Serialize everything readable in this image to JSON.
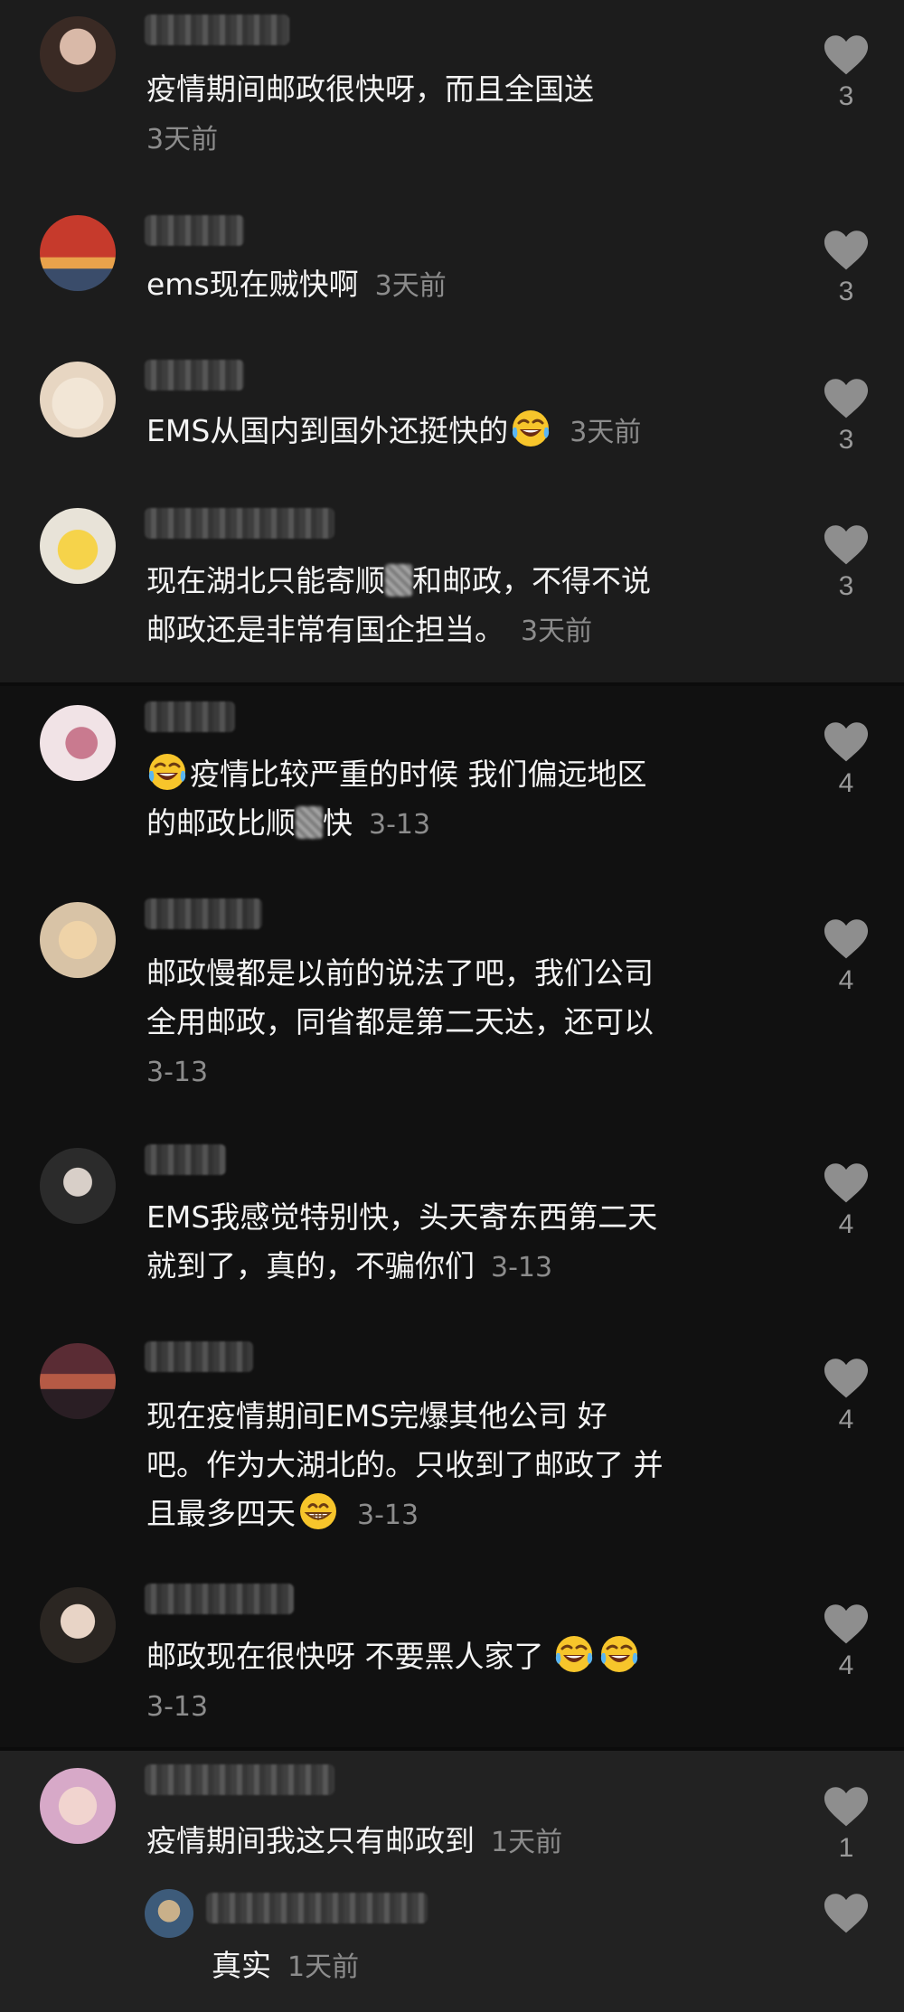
{
  "comments": [
    {
      "text": "疫情期间邮政很快呀，而且全国送",
      "time": "3天前",
      "likes": "3"
    },
    {
      "text": "ems现在贼快啊",
      "time": "3天前",
      "likes": "3"
    },
    {
      "text": "EMS从国内到国外还挺快的",
      "time": "3天前",
      "likes": "3"
    },
    {
      "line1a": "现在湖北只能寄顺",
      "line1b": "和邮政，不得不说",
      "line2": "邮政还是非常有国企担当。",
      "time": "3天前",
      "likes": "3"
    },
    {
      "line1": "疫情比较严重的时候 我们偏远地区",
      "line2a": "的邮政比顺",
      "line2b": "快",
      "time": "3-13",
      "likes": "4"
    },
    {
      "line1": "邮政慢都是以前的说法了吧，我们公司",
      "line2": "全用邮政，同省都是第二天达，还可以",
      "time": "3-13",
      "likes": "4"
    },
    {
      "line1": "EMS我感觉特别快，头天寄东西第二天",
      "line2": "就到了，真的，不骗你们",
      "time": "3-13",
      "likes": "4"
    },
    {
      "line1": "现在疫情期间EMS完爆其他公司 好",
      "line2": "吧。作为大湖北的。只收到了邮政了 并",
      "line3": "且最多四天",
      "time": "3-13",
      "likes": "4"
    },
    {
      "text": "邮政现在很快呀 不要黑人家了",
      "time": "3-13",
      "likes": "4"
    },
    {
      "text": "疫情期间我这只有邮政到",
      "time": "1天前",
      "likes": "1"
    },
    {
      "text": "真实",
      "time": "1天前",
      "likes": ""
    }
  ],
  "icons": {
    "like": "heart-icon",
    "laugh_cry": "laughing-tears-emoji-icon",
    "grin": "grinning-emoji-icon"
  }
}
